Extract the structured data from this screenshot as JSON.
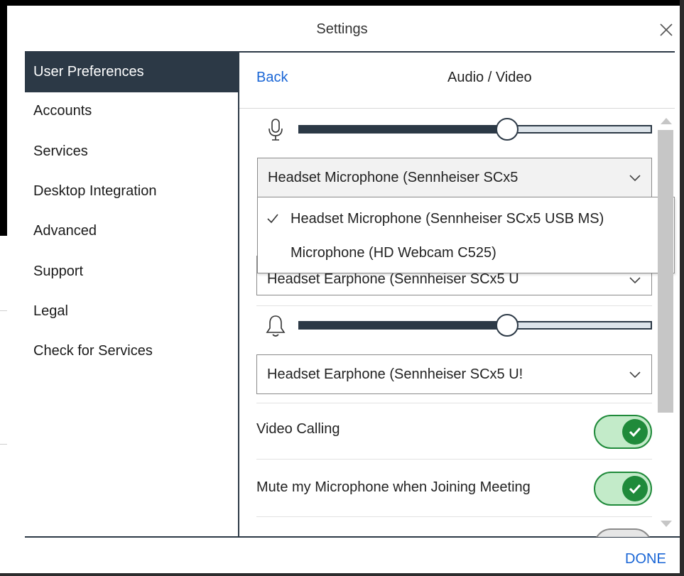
{
  "window": {
    "title": "Settings"
  },
  "sidebar": {
    "items": [
      {
        "label": "User Preferences",
        "active": true
      },
      {
        "label": "Accounts"
      },
      {
        "label": "Services"
      },
      {
        "label": "Desktop Integration"
      },
      {
        "label": "Advanced"
      },
      {
        "label": "Support"
      },
      {
        "label": "Legal"
      },
      {
        "label": "Check for Services"
      }
    ]
  },
  "panel": {
    "back_label": "Back",
    "title": "Audio / Video",
    "microphone": {
      "icon": "microphone-icon",
      "volume_fraction": 0.57,
      "selected": "Headset Microphone (Sennheiser SCx5",
      "options": [
        {
          "label": "Headset Microphone (Sennheiser SCx5 USB MS)",
          "checked": true
        },
        {
          "label": "Microphone (HD Webcam C525)",
          "checked": false
        }
      ]
    },
    "speaker": {
      "selected": "Headset Earphone (Sennheiser SCx5 U"
    },
    "ringer": {
      "icon": "bell-icon",
      "volume_fraction": 0.57,
      "selected": "Headset Earphone (Sennheiser SCx5 U!"
    },
    "toggles": [
      {
        "label": "Video Calling",
        "on": true
      },
      {
        "label": "Mute my Microphone when Joining Meeting",
        "on": true
      }
    ]
  },
  "footer": {
    "done_label": "DONE"
  },
  "colors": {
    "accent": "#1a66d6",
    "sidebar_active": "#2c3946",
    "toggle_on": "#1f8a3a",
    "toggle_on_bg": "#c3ebc9"
  }
}
